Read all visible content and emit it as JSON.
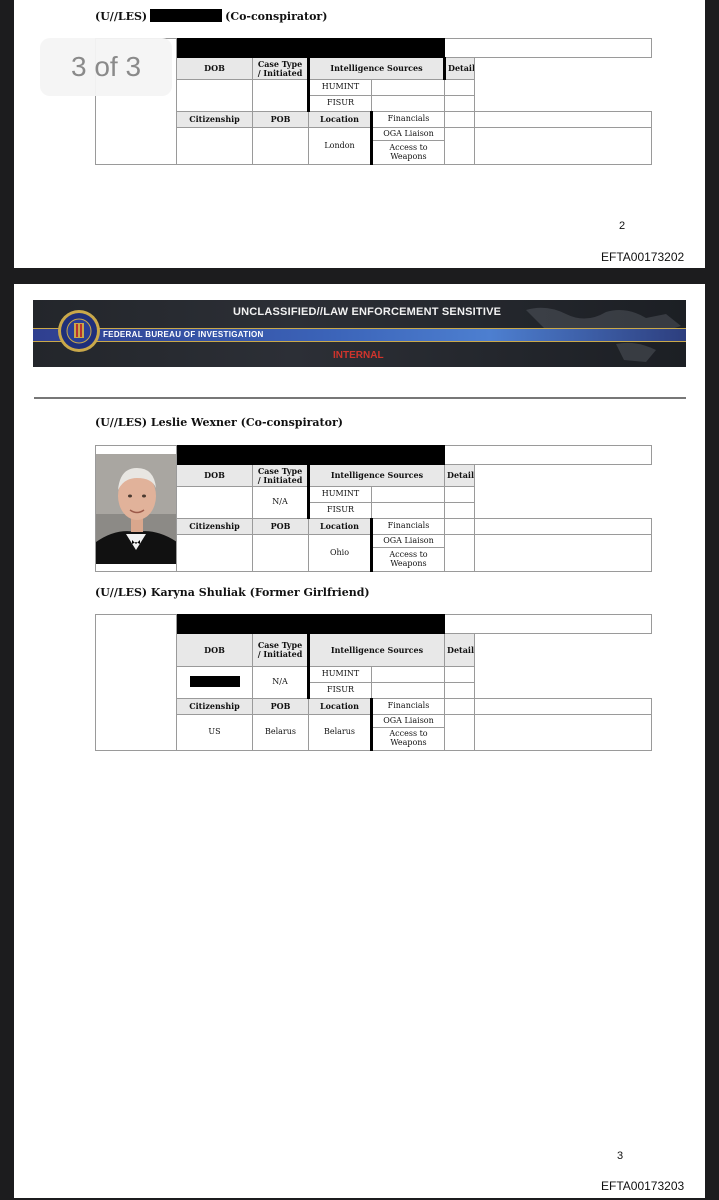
{
  "viewer": {
    "page_counter": "3 of 3"
  },
  "page2": {
    "heading_prefix": "(U//LES)",
    "heading_suffix": "(Co-conspirator)",
    "page_number": "2",
    "doc_id": "EFTA00173202",
    "table": {
      "headers": {
        "dob": "DOB",
        "case_type": "Case Type / Initiated",
        "intel_sources": "Intelligence Sources",
        "details": "Details",
        "citizenship": "Citizenship",
        "pob": "POB",
        "location": "Location"
      },
      "values": {
        "dob": "",
        "case_type": "",
        "citizenship": "",
        "pob": "",
        "location": "London"
      },
      "sources": [
        "HUMINT",
        "FISUR",
        "Financials",
        "OGA Liaison",
        "Access to Weapons"
      ]
    }
  },
  "page3": {
    "banner": {
      "classification": "UNCLASSIFIED//LAW ENFORCEMENT SENSITIVE",
      "agency": "FEDERAL BUREAU OF INVESTIGATION",
      "marking": "INTERNAL",
      "colors": {
        "band": "#3b63b8",
        "marking": "#d0342c",
        "seal": "#1f2f7a"
      }
    },
    "record1": {
      "heading": "(U//LES) Leslie Wexner (Co-conspirator)",
      "photo": "portrait-photo",
      "table": {
        "headers": {
          "dob": "DOB",
          "case_type": "Case Type / Initiated",
          "intel_sources": "Intelligence Sources",
          "details": "Details",
          "citizenship": "Citizenship",
          "pob": "POB",
          "location": "Location"
        },
        "values": {
          "dob": "",
          "case_type": "N/A",
          "citizenship": "",
          "pob": "",
          "location": "Ohio"
        },
        "sources": [
          "HUMINT",
          "FISUR",
          "Financials",
          "OGA Liaison",
          "Access to Weapons"
        ]
      }
    },
    "record2": {
      "heading": "(U//LES) Karyna Shuliak (Former Girlfriend)",
      "table": {
        "headers": {
          "dob": "DOB",
          "case_type": "Case Type / Initiated",
          "intel_sources": "Intelligence Sources",
          "details": "Details",
          "citizenship": "Citizenship",
          "pob": "POB",
          "location": "Location"
        },
        "values": {
          "dob": "[redacted]",
          "case_type": "N/A",
          "citizenship": "US",
          "pob": "Belarus",
          "location": "Belarus"
        },
        "sources": [
          "HUMINT",
          "FISUR",
          "Financials",
          "OGA Liaison",
          "Access to Weapons"
        ]
      }
    },
    "page_number": "3",
    "doc_id": "EFTA00173203"
  }
}
